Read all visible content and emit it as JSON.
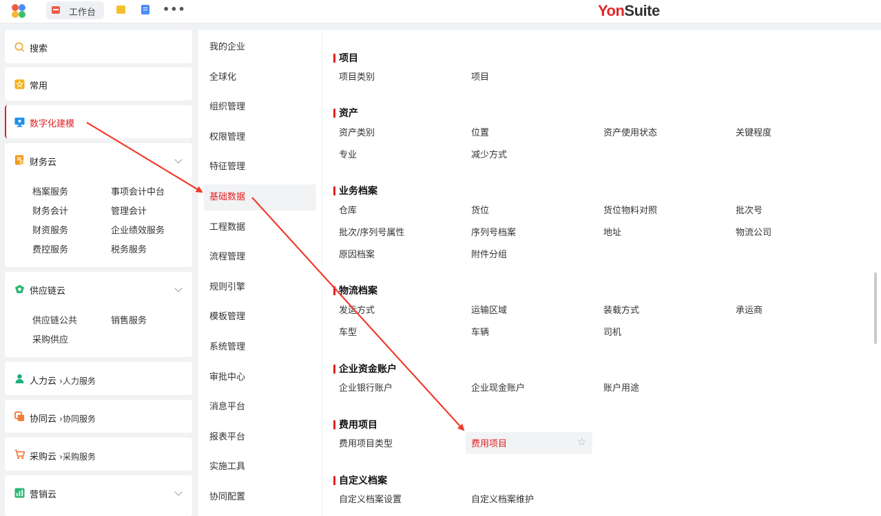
{
  "topbar": {
    "workbench_tab": "工作台",
    "more": "•••",
    "brand_yon": "Yon",
    "brand_suite": "Suite"
  },
  "sidebar": {
    "search": "搜索",
    "frequent": "常用",
    "digital_modeling": "数字化建模",
    "finance": {
      "title": "财务云",
      "items": [
        "档案服务",
        "事项会计中台",
        "财务会计",
        "管理会计",
        "财资服务",
        "企业绩效服务",
        "费控服务",
        "税务服务"
      ]
    },
    "supply_chain": {
      "title": "供应链云",
      "items": [
        "供应链公共",
        "销售服务",
        "采购供应"
      ]
    },
    "hr": {
      "title": "人力云",
      "sub": "人力服务"
    },
    "collab": {
      "title": "协同云",
      "sub": "协同服务"
    },
    "procurement": {
      "title": "采购云",
      "sub": "采购服务"
    },
    "marketing": {
      "title": "营销云"
    }
  },
  "middle_nav": {
    "items": [
      "我的企业",
      "全球化",
      "组织管理",
      "权限管理",
      "特征管理",
      "基础数据",
      "工程数据",
      "流程管理",
      "规则引擎",
      "模板管理",
      "系统管理",
      "审批中心",
      "消息平台",
      "报表平台",
      "实施工具",
      "协同配置"
    ],
    "active": "基础数据"
  },
  "content": {
    "sections": [
      {
        "title": "项目",
        "links": [
          "项目类别",
          "项目"
        ]
      },
      {
        "title": "资产",
        "links": [
          "资产类别",
          "位置",
          "资产使用状态",
          "关键程度",
          "专业",
          "减少方式"
        ]
      },
      {
        "title": "业务档案",
        "links": [
          "仓库",
          "货位",
          "货位物料对照",
          "批次号",
          "批次/序列号属性",
          "序列号档案",
          "地址",
          "物流公司",
          "原因档案",
          "附件分组"
        ]
      },
      {
        "title": "物流档案",
        "links": [
          "发运方式",
          "运输区域",
          "装载方式",
          "承运商",
          "车型",
          "车辆",
          "司机"
        ]
      },
      {
        "title": "企业资金账户",
        "links": [
          "企业银行账户",
          "企业现金账户",
          "账户用途"
        ]
      },
      {
        "title": "费用项目",
        "links": [
          "费用项目类型",
          "费用项目"
        ]
      },
      {
        "title": "自定义档案",
        "links": [
          "自定义档案设置",
          "自定义档案维护"
        ]
      }
    ],
    "active_link": "费用项目",
    "star": "☆"
  },
  "colors": {
    "accent": "#e02020",
    "brand_yon": "#e0262a",
    "brand_suite": "#333333",
    "arrow": "#f03a2c"
  }
}
